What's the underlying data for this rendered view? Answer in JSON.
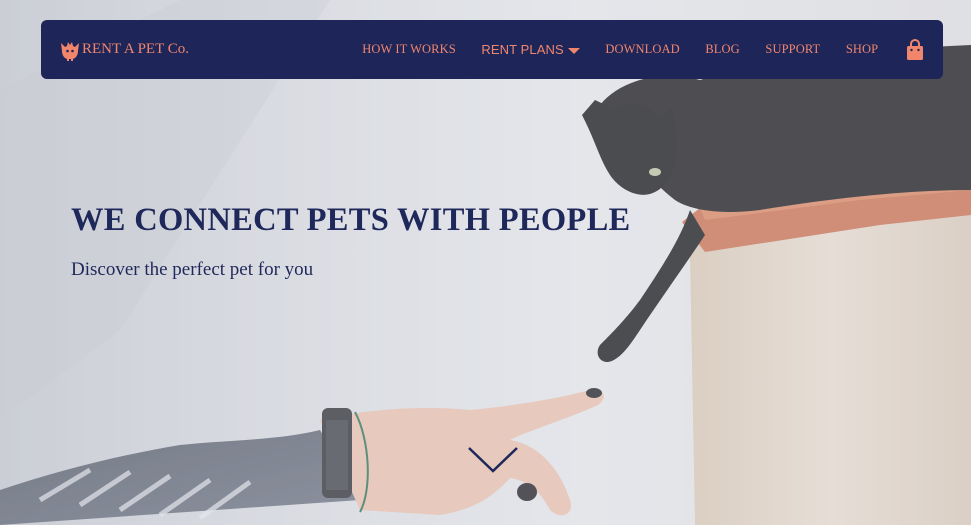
{
  "brand": {
    "name": "RENT A PET Co.",
    "logo_icon": "cat-face-icon"
  },
  "nav": {
    "items": [
      {
        "label": "HOW IT WORKS"
      },
      {
        "label": "RENT PLANS",
        "has_dropdown": true
      },
      {
        "label": "DOWNLOAD"
      },
      {
        "label": "BLOG"
      },
      {
        "label": "SUPPORT"
      },
      {
        "label": "SHOP"
      }
    ],
    "cart_icon": "shopping-bag-icon"
  },
  "hero": {
    "title": "WE CONNECT PETS WITH PEOPLE",
    "subtitle": "Discover the perfect pet for you",
    "scroll_icon": "chevron-down-icon"
  },
  "colors": {
    "navbar_bg": "#1e2559",
    "accent": "#f1866d",
    "heading": "#1f285a"
  }
}
